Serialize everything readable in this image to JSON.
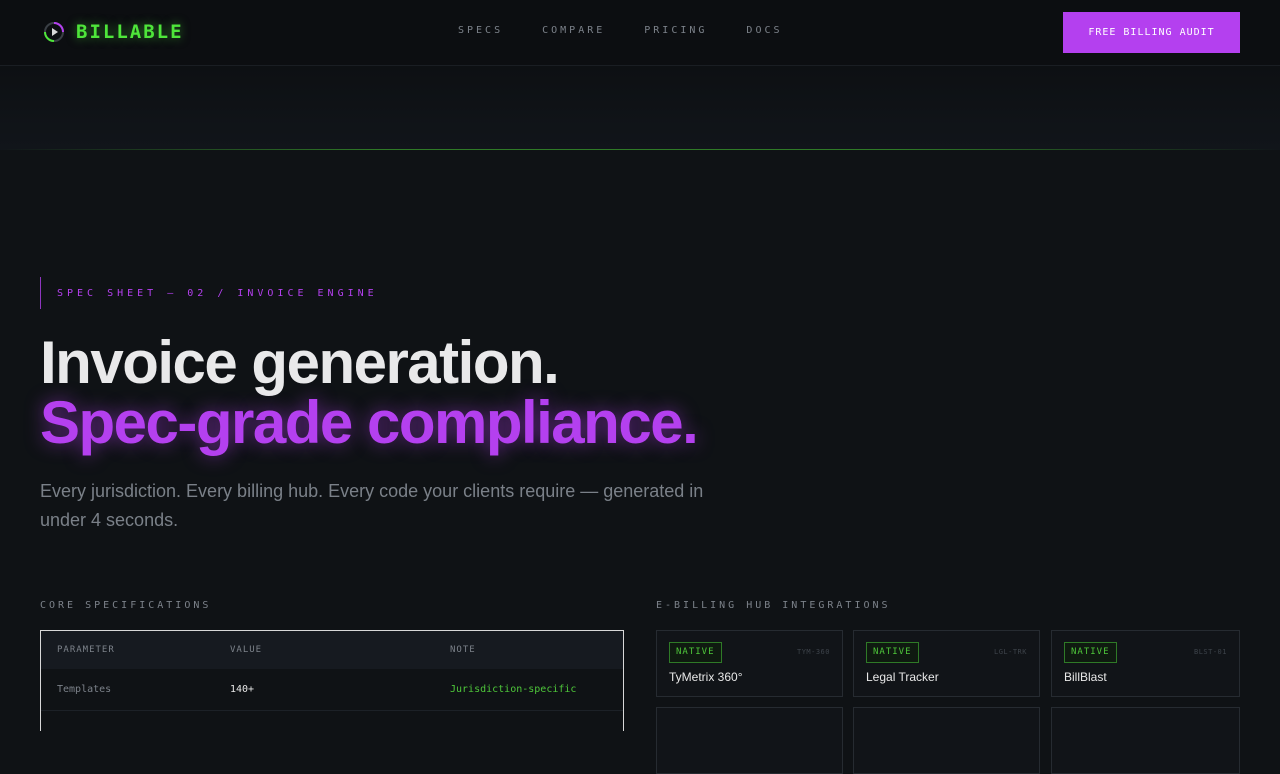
{
  "brand": {
    "name": "BILLABLE",
    "color": "#4ee53a",
    "icon": "billable-logo-icon"
  },
  "nav": {
    "links": [
      "SPECS",
      "COMPARE",
      "PRICING",
      "DOCS"
    ],
    "cta": "FREE BILLING AUDIT"
  },
  "hero": {
    "eyebrow": "SPEC SHEET — 02 / INVOICE ENGINE",
    "headline_line1": "Invoice generation.",
    "headline_line2": "Spec-grade compliance.",
    "subtitle": "Every jurisdiction. Every billing hub. Every code your clients require — generated in under 4 seconds."
  },
  "specs": {
    "label": "CORE SPECIFICATIONS",
    "columns": [
      "PARAMETER",
      "VALUE",
      "NOTE"
    ],
    "rows": [
      {
        "parameter": "Templates",
        "value": "140+",
        "note": "Jurisdiction-specific"
      }
    ]
  },
  "integrations": {
    "label": "E-BILLING HUB INTEGRATIONS",
    "cards": [
      {
        "badge": "NATIVE",
        "code": "TYM-360",
        "name": "TyMetrix 360°"
      },
      {
        "badge": "NATIVE",
        "code": "LGL-TRK",
        "name": "Legal Tracker"
      },
      {
        "badge": "NATIVE",
        "code": "BLST-01",
        "name": "BillBlast"
      }
    ]
  },
  "colors": {
    "accent": "#b440ef",
    "green": "#4ec63a",
    "background": "#0f1215"
  }
}
